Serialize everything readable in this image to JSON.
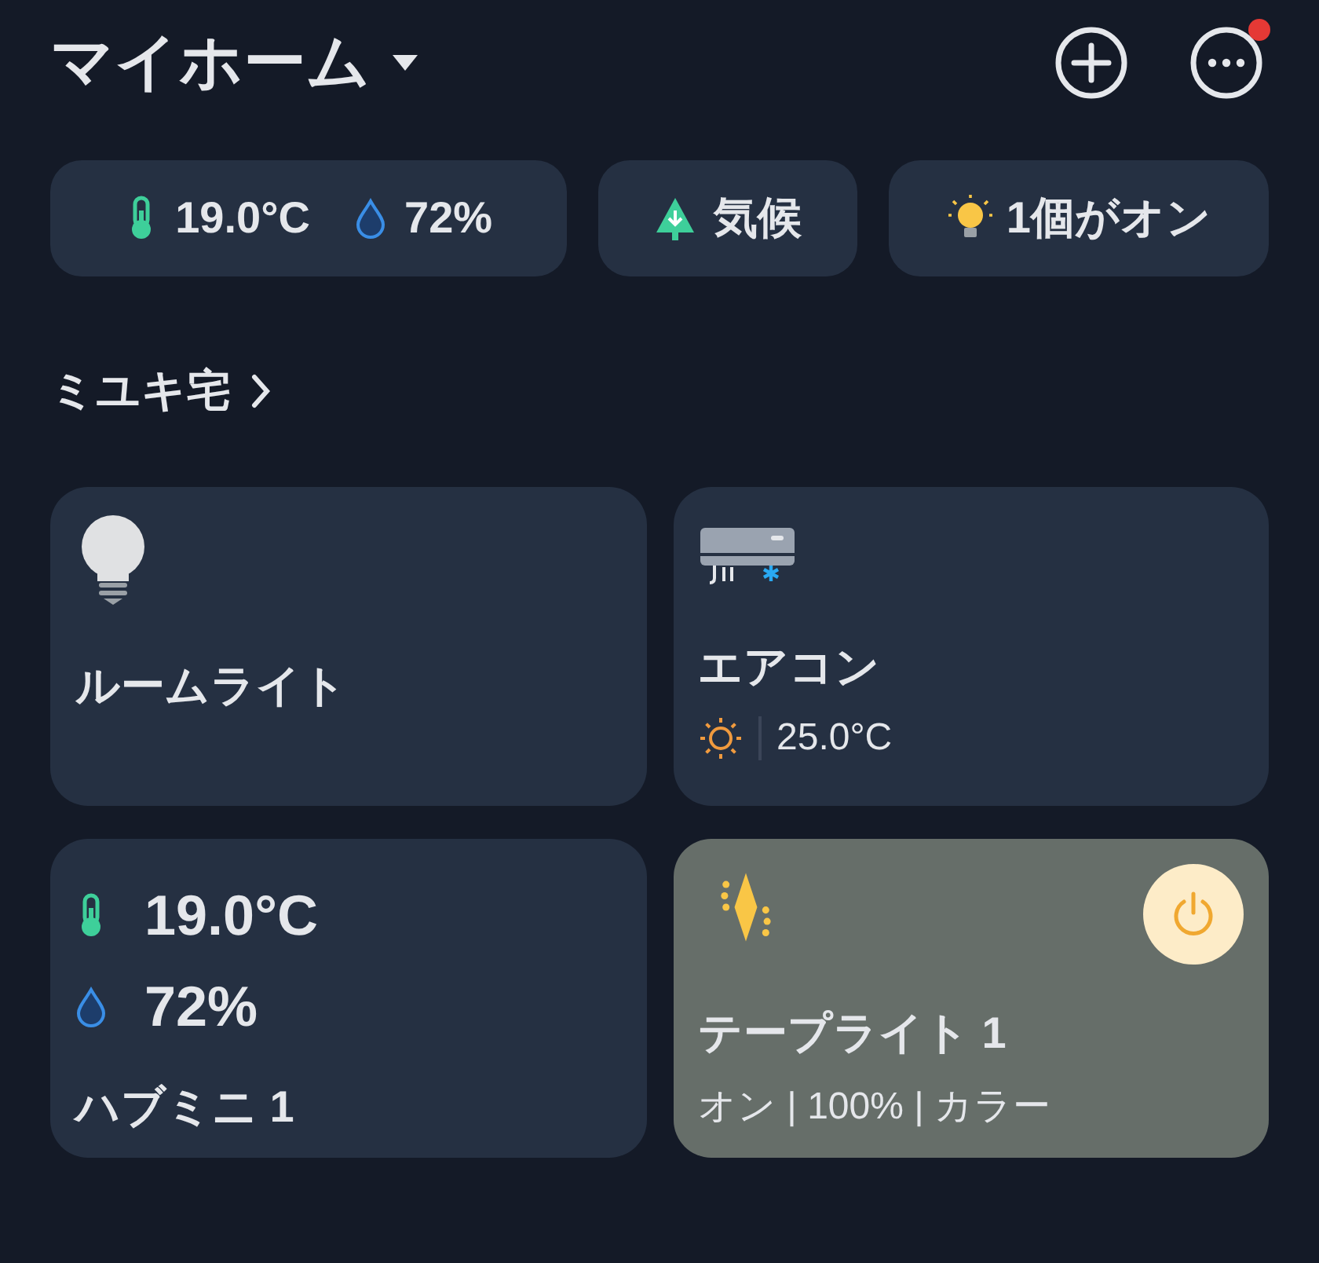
{
  "header": {
    "title": "マイホーム",
    "notification": true
  },
  "chips": [
    {
      "kind": "climate_summary",
      "temperature": "19.0°C",
      "humidity": "72%"
    },
    {
      "kind": "climate",
      "label": "気候"
    },
    {
      "kind": "lights",
      "label": "1個がオン"
    }
  ],
  "section": {
    "title": "ミユキ宅"
  },
  "devices": [
    {
      "kind": "light",
      "name": "ルームライト",
      "on": false
    },
    {
      "kind": "aircon",
      "name": "エアコン",
      "heating": true,
      "setpoint": "25.0°C"
    },
    {
      "kind": "sensor",
      "name": "ハブミニ 1",
      "temperature": "19.0°C",
      "humidity": "72%"
    },
    {
      "kind": "tape_light",
      "name": "テープライト 1",
      "on": true,
      "status": "オン | 100% | カラー"
    }
  ]
}
